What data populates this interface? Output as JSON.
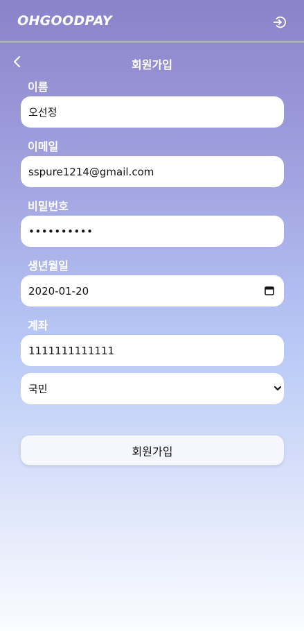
{
  "header": {
    "logo": "OHGOODPAY",
    "logout_icon": "logout-icon"
  },
  "subheader": {
    "back_icon": "chevron-left-icon",
    "title": "회원가입"
  },
  "form": {
    "name": {
      "label": "이름",
      "value": "오선정"
    },
    "email": {
      "label": "이메일",
      "value": "sspure1214@gmail.com"
    },
    "password": {
      "label": "비밀번호",
      "value": "••••••••••"
    },
    "birthdate": {
      "label": "생년월일",
      "value": "2020-01-20",
      "icon": "calendar-icon"
    },
    "account": {
      "label": "계좌",
      "value": "1111111111111"
    },
    "bank": {
      "selected": "국민",
      "icon": "chevron-down-icon"
    },
    "submit_label": "회원가입"
  },
  "colors": {
    "gradient_top": "#8b82c9",
    "gradient_mid": "#b8c9f6",
    "gradient_bottom": "#fbfcff",
    "field_bg": "#ffffff",
    "button_bg": "#f6f7fd"
  }
}
